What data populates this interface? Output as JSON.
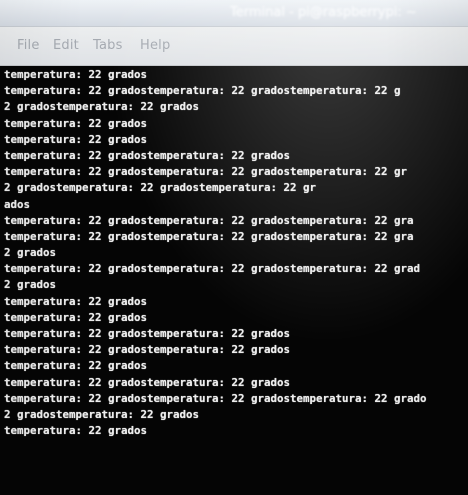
{
  "window": {
    "title": "Terminal - pi@raspberrypi: ~"
  },
  "menubar": {
    "items": [
      {
        "label": "File"
      },
      {
        "label": "Edit"
      },
      {
        "label": "Tabs"
      },
      {
        "label": "Help"
      }
    ]
  },
  "terminal": {
    "lines": [
      "temperatura: 22 grados",
      "temperatura: 22 gradostemperatura: 22 gradostemperatura: 22 g",
      "2 gradostemperatura: 22 grados",
      "temperatura: 22 grados",
      "temperatura: 22 grados",
      "temperatura: 22 gradostemperatura: 22 grados",
      "temperatura: 22 gradostemperatura: 22 gradostemperatura: 22 gr",
      "2 gradostemperatura: 22 gradostemperatura: 22 gr",
      "ados",
      "temperatura: 22 gradostemperatura: 22 gradostemperatura: 22 gra",
      "temperatura: 22 gradostemperatura: 22 gradostemperatura: 22 gra",
      "2 grados",
      "temperatura: 22 gradostemperatura: 22 gradostemperatura: 22 grad",
      "2 grados",
      "temperatura: 22 grados",
      "temperatura: 22 grados",
      "temperatura: 22 gradostemperatura: 22 grados",
      "temperatura: 22 gradostemperatura: 22 grados",
      "temperatura: 22 grados",
      "temperatura: 22 gradostemperatura: 22 grados",
      "temperatura: 22 gradostemperatura: 22 gradostemperatura: 22 grado",
      "2 gradostemperatura: 22 grados",
      "temperatura: 22 grados"
    ]
  },
  "colors": {
    "terminal_background": "#050505",
    "terminal_text": "#ededed",
    "menubar_background": "#e4e6e9",
    "menu_text": "#a5aab1"
  }
}
